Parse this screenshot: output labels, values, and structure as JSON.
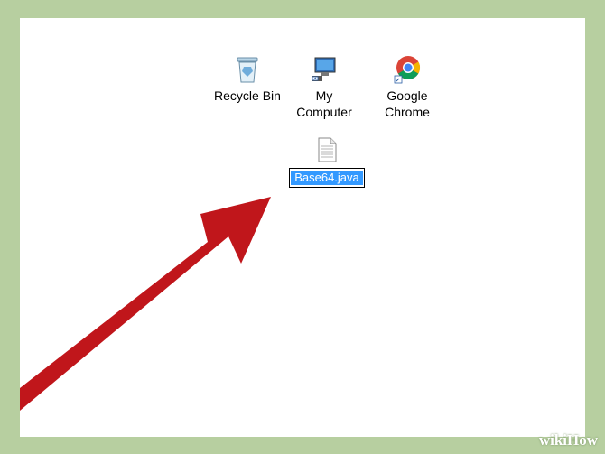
{
  "desktop": {
    "icons": [
      {
        "label": "Recycle Bin",
        "icon": "recycle-bin-icon"
      },
      {
        "label": "My\nComputer",
        "icon": "computer-icon"
      },
      {
        "label": "Google\nChrome",
        "icon": "chrome-icon"
      }
    ],
    "file": {
      "name_value": "Base64.java",
      "icon": "text-file-icon"
    }
  },
  "arrow_color": "#c0161b",
  "watermark": "wikiHow"
}
